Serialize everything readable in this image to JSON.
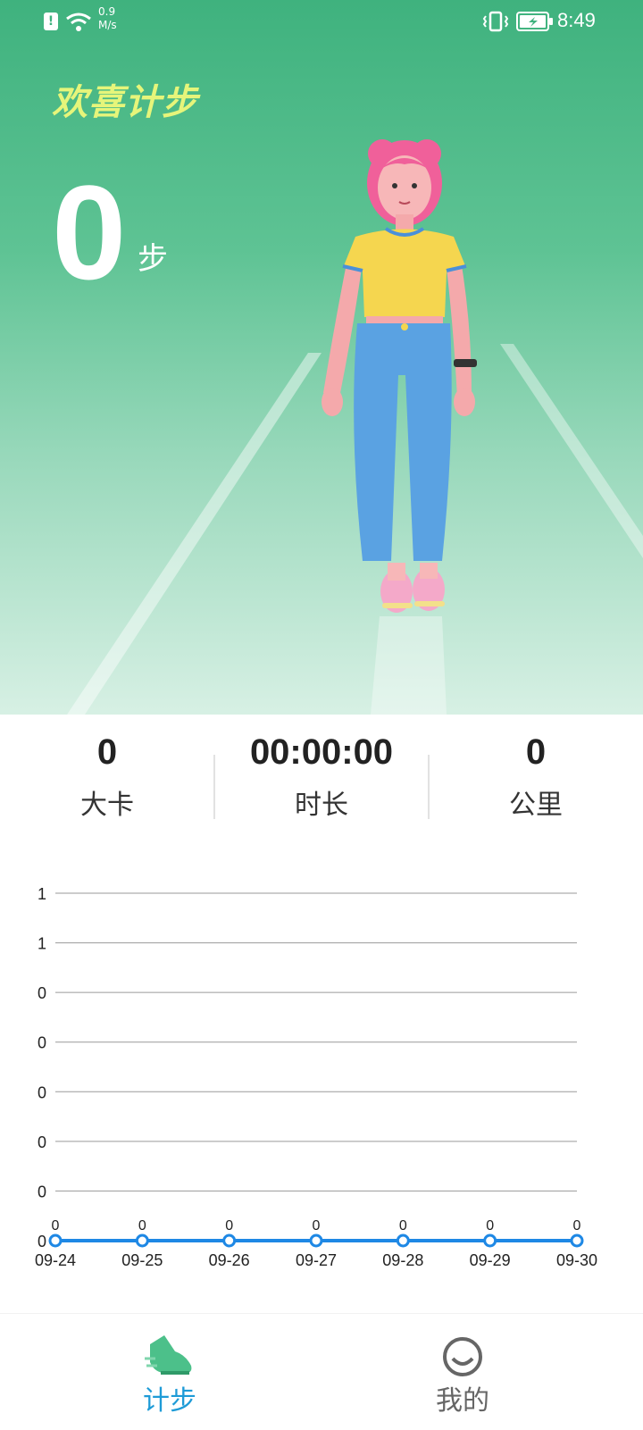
{
  "status_bar": {
    "alert_glyph": "!",
    "speed_value": "0.9",
    "speed_unit": "M/s",
    "time": "8:49",
    "icons": [
      "alert-icon",
      "wifi-icon",
      "vibrate-icon",
      "battery-charging-icon"
    ]
  },
  "hero": {
    "title": "欢喜计步",
    "steps": "0",
    "steps_unit": "步"
  },
  "stats": [
    {
      "value": "0",
      "label": "大卡"
    },
    {
      "value": "00:00:00",
      "label": "时长"
    },
    {
      "value": "0",
      "label": "公里"
    }
  ],
  "chart_data": {
    "type": "line",
    "categories": [
      "09-24",
      "09-25",
      "09-26",
      "09-27",
      "09-28",
      "09-29",
      "09-30"
    ],
    "series": [
      {
        "values": [
          0,
          0,
          0,
          0,
          0,
          0,
          0
        ]
      }
    ],
    "data_labels": [
      "0",
      "0",
      "0",
      "0",
      "0",
      "0",
      "0"
    ],
    "y_tick_labels": [
      "1",
      "1",
      "0",
      "0",
      "0",
      "0",
      "0"
    ],
    "ylim": [
      0,
      1
    ],
    "grid": true,
    "line_color": "#1e88e5",
    "title": "",
    "xlabel": "",
    "ylabel": ""
  },
  "tabs": [
    {
      "label": "计步",
      "icon": "sneaker-icon",
      "active": true
    },
    {
      "label": "我的",
      "icon": "smiley-icon",
      "active": false
    }
  ],
  "colors": {
    "accent": "#1e9bd7",
    "hero_green": "#3fb27e",
    "title_yellow": "#e6f57a",
    "inactive_tab": "#666666"
  }
}
